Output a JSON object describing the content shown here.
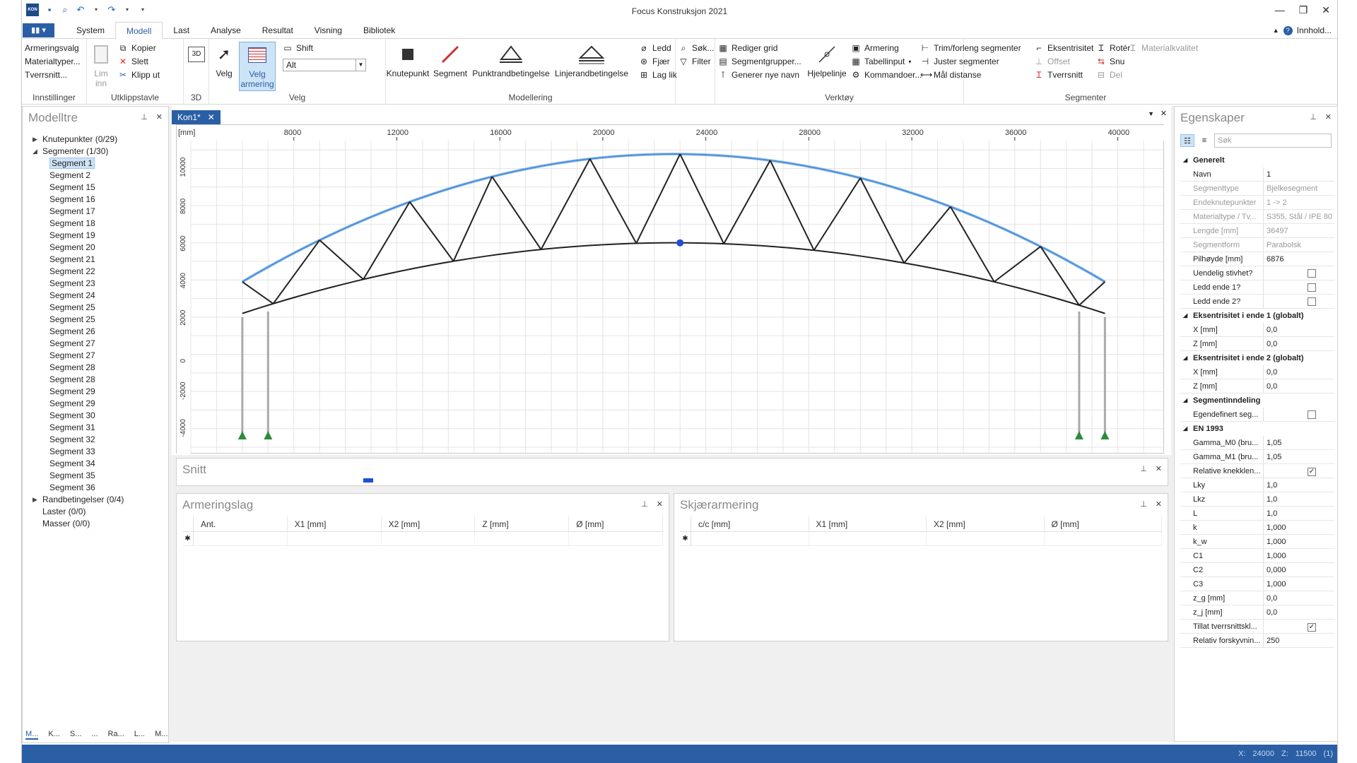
{
  "window": {
    "title": "Focus Konstruksjon 2021"
  },
  "tabs": {
    "file": "▮▮ ▾",
    "items": [
      "System",
      "Modell",
      "Last",
      "Analyse",
      "Resultat",
      "Visning",
      "Bibliotek"
    ],
    "help": "Innhold..."
  },
  "ribbon": {
    "innstillinger": {
      "label": "Innstillinger",
      "items": [
        "Armeringsvalg",
        "Materialtyper...",
        "Tverrsnitt..."
      ]
    },
    "utklipp": {
      "label": "Utklippstavle",
      "lim": "Lim",
      "inn": "inn",
      "kopier": "Kopier",
      "slett": "Slett",
      "klipp": "Klipp ut"
    },
    "d3": {
      "label": "3D",
      "btn": "3D"
    },
    "velg": {
      "label": "Velg",
      "velg_btn": "Velg",
      "velg_arm": "Velg",
      "velg_arm2": "armering",
      "shift": "Shift",
      "alt": "Alt"
    },
    "modellering": {
      "label": "Modellering",
      "knutepunkt": "Knutepunkt",
      "segment": "Segment",
      "punkt": "Punktrandbetingelse",
      "linje": "Linjerandbetingelse",
      "ledd": "Ledd",
      "fjaer": "Fjær",
      "laglik": "Lag lik",
      "sok": "Søk...",
      "filter": "Filter"
    },
    "verktoy": {
      "label": "Verktøy",
      "grid": "Rediger grid",
      "seggrp": "Segmentgrupper...",
      "generer": "Generer nye navn",
      "hjelpelinje": "Hjelpelinje",
      "armering": "Armering",
      "tabell": "Tabellinput",
      "kommando": "Kommandoer..."
    },
    "segmenter": {
      "label": "Segmenter",
      "trim": "Trim/forleng segmenter",
      "juster": "Juster segmenter",
      "maal": "Mål distanse",
      "eksentrisitet": "Eksentrisitet",
      "offset": "Offset",
      "tverrsnitt": "Tverrsnitt",
      "roter": "Rotér",
      "snu": "Snu",
      "del": "Del",
      "materialkvalitet": "Materialkvalitet"
    }
  },
  "modelltre": {
    "title": "Modelltre",
    "knutepunkter": "Knutepunkter (0/29)",
    "segmenter": "Segmenter (1/30)",
    "segments": [
      "Segment 1",
      "Segment 2",
      "Segment 15",
      "Segment 16",
      "Segment 17",
      "Segment 18",
      "Segment 19",
      "Segment 20",
      "Segment 21",
      "Segment 22",
      "Segment 23",
      "Segment 24",
      "Segment 25",
      "Segment 25",
      "Segment 26",
      "Segment 27",
      "Segment 27",
      "Segment 28",
      "Segment 28",
      "Segment 29",
      "Segment 29",
      "Segment 30",
      "Segment 31",
      "Segment 32",
      "Segment 33",
      "Segment 34",
      "Segment 35",
      "Segment 36"
    ],
    "randbetingelser": "Randbetingelser (0/4)",
    "laster": "Laster (0/0)",
    "masser": "Masser (0/0)",
    "bottom_tabs": [
      "M...",
      "K...",
      "S...",
      "...",
      "Ra...",
      "L...",
      "M..."
    ]
  },
  "document": {
    "tab": "Kon1*",
    "unit": "[mm]",
    "x_ticks": [
      "8000",
      "12000",
      "16000",
      "20000",
      "24000",
      "28000",
      "32000",
      "36000",
      "40000"
    ],
    "y_ticks": [
      "10000",
      "8000",
      "6000",
      "4000",
      "2000",
      "0",
      "-2000",
      "-4000"
    ]
  },
  "snitt": {
    "title": "Snitt"
  },
  "armeringslag": {
    "title": "Armeringslag",
    "columns": [
      "Ant.",
      "X1 [mm]",
      "X2 [mm]",
      "Z [mm]",
      "Ø [mm]"
    ]
  },
  "skjaer": {
    "title": "Skjærarmering",
    "columns": [
      "c/c [mm]",
      "X1 [mm]",
      "X2 [mm]",
      "Ø [mm]"
    ]
  },
  "egenskaper": {
    "title": "Egenskaper",
    "search": "Søk",
    "generelt": "Generelt",
    "p_navn": [
      "Navn",
      "1"
    ],
    "p_type": [
      "Segmenttype",
      "Bjelkesegment"
    ],
    "p_ende": [
      "Endeknutepunkter",
      "1 -> 2"
    ],
    "p_mat": [
      "Materialtype / Tv...",
      "S355, Stål / IPE 80 /..."
    ],
    "p_lengde": [
      "Lengde [mm]",
      "36497"
    ],
    "p_form": [
      "Segmentform",
      "Parabolsk"
    ],
    "p_pil": [
      "Pilhøyde [mm]",
      "6876"
    ],
    "p_uendelig": [
      "Uendelig stivhet?",
      ""
    ],
    "p_ledd1": [
      "Ledd ende 1?",
      ""
    ],
    "p_ledd2": [
      "Ledd ende 2?",
      ""
    ],
    "eks1": "Eksentrisitet i ende 1 (globalt)",
    "e1x": [
      "X [mm]",
      "0,0"
    ],
    "e1z": [
      "Z [mm]",
      "0,0"
    ],
    "eks2": "Eksentrisitet i ende 2 (globalt)",
    "e2x": [
      "X [mm]",
      "0,0"
    ],
    "e2z": [
      "Z [mm]",
      "0,0"
    ],
    "seginndeling": "Segmentinndeling",
    "p_egen": [
      "Egendefinert seg...",
      ""
    ],
    "en": "EN 1993",
    "g0": [
      "Gamma_M0 (bru...",
      "1,05"
    ],
    "g1": [
      "Gamma_M1 (bru...",
      "1,05"
    ],
    "rel": [
      "Relative knekklen...",
      ""
    ],
    "lky": [
      "Lky",
      "1,0"
    ],
    "lkz": [
      "Lkz",
      "1,0"
    ],
    "l": [
      "L",
      "1,0"
    ],
    "k": [
      "k",
      "1,000"
    ],
    "kw": [
      "k_w",
      "1,000"
    ],
    "c1": [
      "C1",
      "1,000"
    ],
    "c2": [
      "C2",
      "0,000"
    ],
    "c3": [
      "C3",
      "1,000"
    ],
    "zg": [
      "z_g [mm]",
      "0,0"
    ],
    "zj": [
      "z_j [mm]",
      "0,0"
    ],
    "tillat": [
      "Tillat tverrsnittskl...",
      ""
    ],
    "relf": [
      "Relativ forskyvnin...",
      "250"
    ]
  },
  "status": {
    "x_label": "X:",
    "x": "24000",
    "z_label": "Z:",
    "z": "11500",
    "extra": "(1)"
  },
  "colors": {
    "accent": "#2b5fa5",
    "selected_arch": "#4a90d9"
  }
}
